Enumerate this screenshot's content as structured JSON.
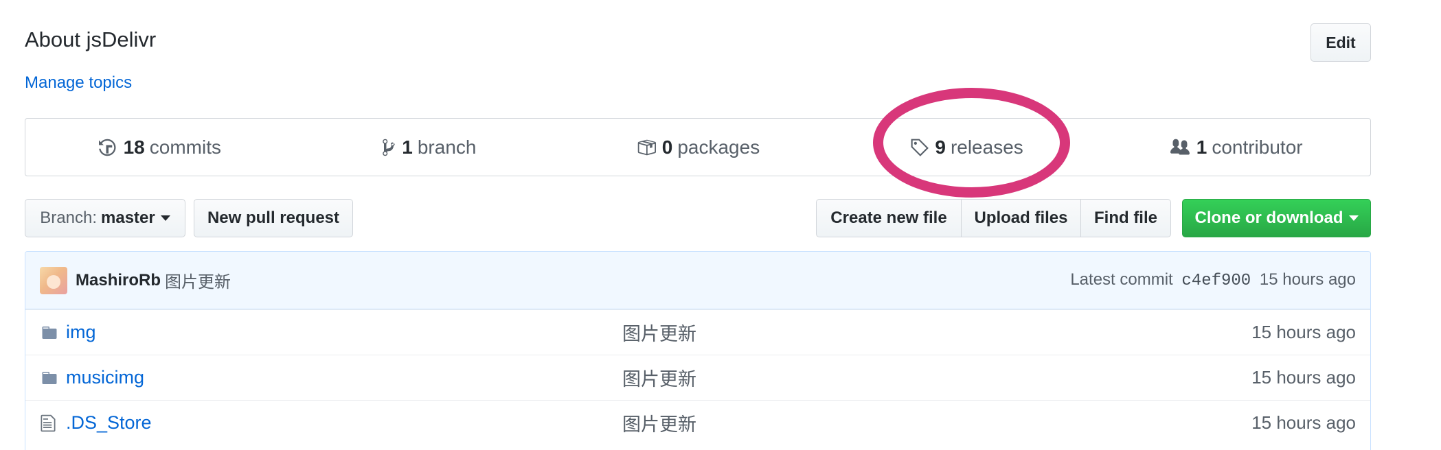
{
  "about": {
    "title": "About jsDelivr",
    "manage_topics": "Manage topics",
    "edit_label": "Edit"
  },
  "summary": [
    {
      "icon": "history-icon",
      "count": "18",
      "label": "commits"
    },
    {
      "icon": "git-branch-icon",
      "count": "1",
      "label": "branch"
    },
    {
      "icon": "package-icon",
      "count": "0",
      "label": "packages"
    },
    {
      "icon": "tag-icon",
      "count": "9",
      "label": "releases"
    },
    {
      "icon": "people-icon",
      "count": "1",
      "label": "contributor"
    }
  ],
  "toolbar": {
    "branch_prefix": "Branch:",
    "branch_name": "master",
    "new_pr": "New pull request",
    "create_file": "Create new file",
    "upload_files": "Upload files",
    "find_file": "Find file",
    "clone": "Clone or download"
  },
  "latest_commit": {
    "author": "MashiroRb",
    "message": "图片更新",
    "prefix": "Latest commit",
    "sha": "c4ef900",
    "age": "15 hours ago"
  },
  "files": [
    {
      "type": "folder",
      "icon": "folder-icon",
      "name": "img",
      "message": "图片更新",
      "age": "15 hours ago"
    },
    {
      "type": "folder",
      "icon": "folder-icon",
      "name": "musicimg",
      "message": "图片更新",
      "age": "15 hours ago"
    },
    {
      "type": "file",
      "icon": "file-icon",
      "name": ".DS_Store",
      "message": "图片更新",
      "age": "15 hours ago"
    }
  ],
  "colors": {
    "link": "#0366d6",
    "annotation": "#d8377a",
    "clone_green": "#28a745"
  }
}
